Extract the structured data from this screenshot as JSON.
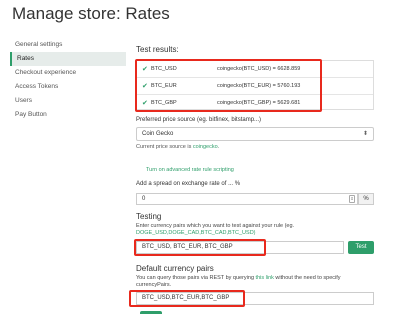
{
  "page": {
    "title": "Manage store: Rates"
  },
  "sidebar": {
    "items": [
      {
        "label": "General settings",
        "active": false
      },
      {
        "label": "Rates",
        "active": true
      },
      {
        "label": "Checkout experience",
        "active": false
      },
      {
        "label": "Access Tokens",
        "active": false
      },
      {
        "label": "Users",
        "active": false
      },
      {
        "label": "Pay Button",
        "active": false
      }
    ]
  },
  "results": {
    "title": "Test results:",
    "rows": [
      {
        "pair": "BTC_USD",
        "expr": "coingecko(BTC_USD) = 6628.859"
      },
      {
        "pair": "BTC_EUR",
        "expr": "coingecko(BTC_EUR) = 5760.193"
      },
      {
        "pair": "BTC_GBP",
        "expr": "coingecko(BTC_GBP) = 5629.681"
      }
    ]
  },
  "source": {
    "label": "Preferred price source (eg. bitfinex, bitstamp...)",
    "selected": "Coin Gecko",
    "hint_prefix": "Current price source is ",
    "hint_link": "coingecko",
    "hint_suffix": "."
  },
  "advanced": {
    "label": "Turn on advanced rate rule scripting"
  },
  "spread": {
    "label": "Add a spread on exchange rate of ... %",
    "value": "0",
    "unit": "%"
  },
  "testing": {
    "title": "Testing",
    "desc": "Enter currency pairs which you want to test against your rule (eg.",
    "example": "DOGE_USD,DOGE_CAD,BTC_CAD,BTC_USD)",
    "value": "BTC_USD, BTC_EUR, BTC_GBP",
    "button": "Test"
  },
  "default_pairs": {
    "title": "Default currency pairs",
    "desc_prefix": "You can query those pairs via REST by querying ",
    "desc_link": "this link",
    "desc_suffix": " without the need to specify",
    "desc_line2": "currencyPairs.",
    "value": "BTC_USD,BTC_EUR,BTC_GBP"
  },
  "colors": {
    "accent": "#2e9e6a",
    "highlight": "#e8291d"
  }
}
